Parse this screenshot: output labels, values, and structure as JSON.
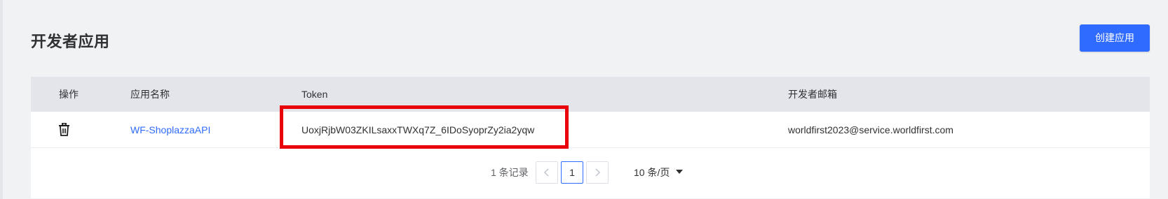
{
  "header": {
    "title": "开发者应用",
    "create_button_label": "创建应用"
  },
  "table": {
    "columns": {
      "operation": "操作",
      "app_name": "应用名称",
      "token": "Token",
      "developer_email": "开发者邮箱"
    },
    "rows": [
      {
        "operation_icon": "trash-icon",
        "app_name": "WF-ShoplazzaAPI",
        "token": "UoxjRjbW03ZKILsaxxTWXq7Z_6IDoSyoprZy2ia2yqw",
        "developer_email": "worldfirst2023@service.worldfirst.com"
      }
    ]
  },
  "pagination": {
    "total_text": "1 条记录",
    "prev_icon": "chevron-left-icon",
    "current_page": "1",
    "next_icon": "chevron-right-icon",
    "page_size_text": "10 条/页",
    "page_size_icon": "caret-down-icon"
  },
  "colors": {
    "accent": "#2f6bff",
    "highlight": "#e8000b",
    "header_bg": "#e3e5eb",
    "page_bg": "#f1f2f4"
  }
}
